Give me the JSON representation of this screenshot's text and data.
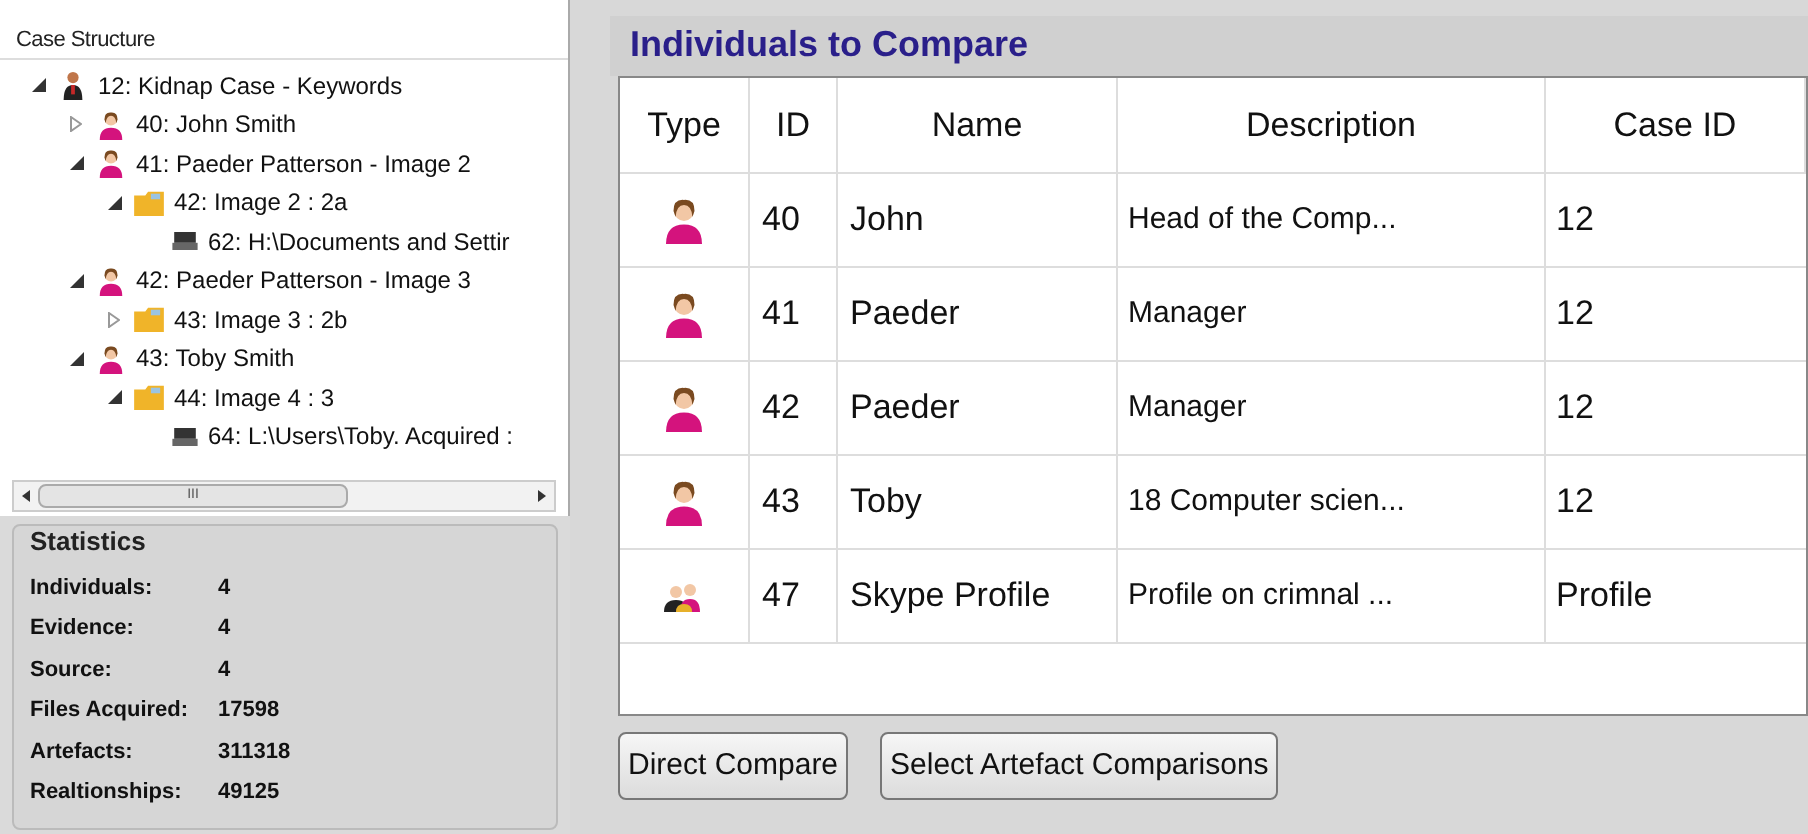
{
  "case_structure": {
    "title": "Case Structure",
    "tree": [
      {
        "kind": "case",
        "label": "12: Kidnap Case - Keywords",
        "expanded": true,
        "children": [
          {
            "kind": "person",
            "label": "40: John  Smith",
            "expanded": false
          },
          {
            "kind": "person",
            "label": "41: Paeder Patterson - Image 2",
            "expanded": true,
            "children": [
              {
                "kind": "folder",
                "label": "42: Image 2 : 2a",
                "expanded": true,
                "children": [
                  {
                    "kind": "drive",
                    "label": "62: H:\\Documents and Settir"
                  }
                ]
              }
            ]
          },
          {
            "kind": "person",
            "label": "42: Paeder Patterson - Image 3",
            "expanded": true,
            "children": [
              {
                "kind": "folder",
                "label": "43: Image 3 : 2b",
                "expanded": false
              }
            ]
          },
          {
            "kind": "person",
            "label": "43: Toby Smith",
            "expanded": true,
            "children": [
              {
                "kind": "folder",
                "label": "44: Image 4 : 3",
                "expanded": true,
                "children": [
                  {
                    "kind": "drive",
                    "label": "64: L:\\Users\\Toby. Acquired :"
                  }
                ]
              }
            ]
          }
        ]
      }
    ],
    "scroll_thumb": "III"
  },
  "statistics": {
    "title": "Statistics",
    "rows": [
      {
        "label": "Individuals:",
        "value": "4"
      },
      {
        "label": "Evidence:",
        "value": "4"
      },
      {
        "label": "Source:",
        "value": "4"
      },
      {
        "label": "Files Acquired:",
        "value": "17598"
      },
      {
        "label": "Artefacts:",
        "value": "311318"
      },
      {
        "label": "Realtionships:",
        "value": "49125"
      }
    ]
  },
  "compare": {
    "title": "Individuals to Compare",
    "columns": [
      "Type",
      "ID",
      "Name",
      "Description",
      "Case ID"
    ],
    "rows": [
      {
        "kind": "person",
        "id": "40",
        "name": "John",
        "description": "Head of the Comp...",
        "case_id": "12"
      },
      {
        "kind": "person",
        "id": "41",
        "name": "Paeder",
        "description": "Manager",
        "case_id": "12"
      },
      {
        "kind": "person",
        "id": "42",
        "name": "Paeder",
        "description": "Manager",
        "case_id": "12"
      },
      {
        "kind": "person",
        "id": "43",
        "name": "Toby",
        "description": "18 Computer scien...",
        "case_id": "12"
      },
      {
        "kind": "group",
        "id": "47",
        "name": "Skype Profile",
        "description": "Profile on crimnal ...",
        "case_id": "Profile"
      }
    ],
    "buttons": [
      "Direct Compare",
      "Select Artefact Comparisons"
    ]
  }
}
